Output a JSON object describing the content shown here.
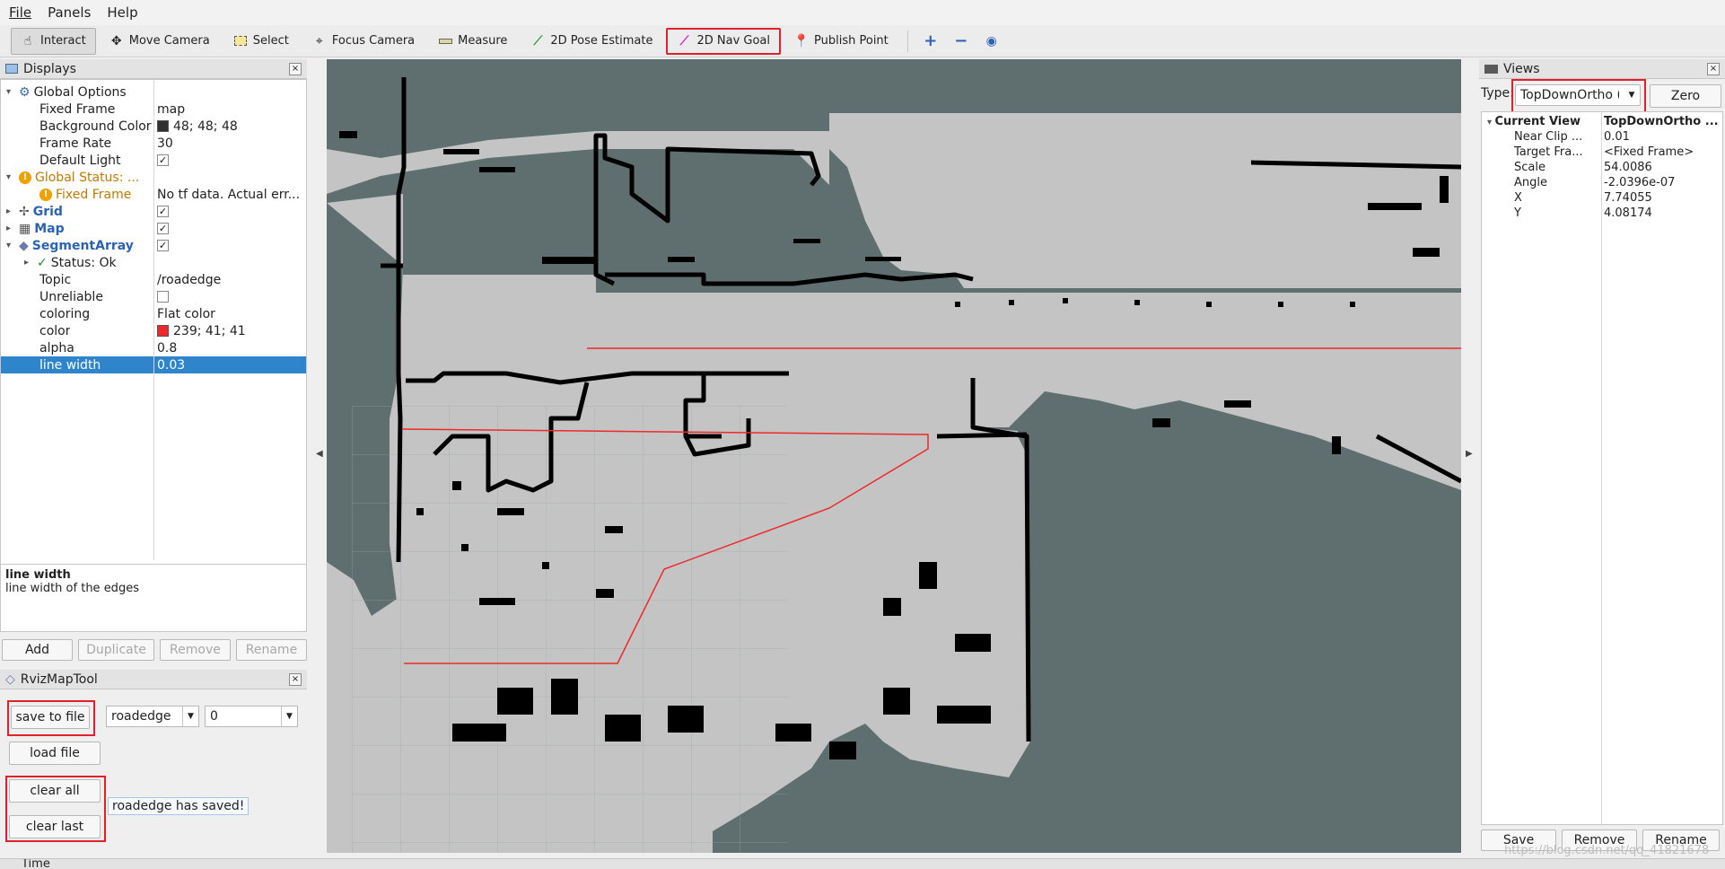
{
  "menu": {
    "file": "File",
    "panels": "Panels",
    "help": "Help"
  },
  "toolbar": {
    "interact": "Interact",
    "move_camera": "Move Camera",
    "select": "Select",
    "focus_camera": "Focus Camera",
    "measure": "Measure",
    "pose_estimate": "2D Pose Estimate",
    "nav_goal": "2D Nav Goal",
    "publish_point": "Publish Point"
  },
  "displays": {
    "title": "Displays",
    "rows": {
      "global_options": "Global Options",
      "fixed_frame_k": "Fixed Frame",
      "fixed_frame_v": "map",
      "bg_color_k": "Background Color",
      "bg_color_v": "48; 48; 48",
      "frame_rate_k": "Frame Rate",
      "frame_rate_v": "30",
      "default_light_k": "Default Light",
      "global_status_k": "Global Status: ...",
      "status_fixed_frame_k": "Fixed Frame",
      "status_fixed_frame_v": "No tf data.  Actual err...",
      "grid": "Grid",
      "map": "Map",
      "segment_array": "SegmentArray",
      "status_ok": "Status: Ok",
      "topic_k": "Topic",
      "topic_v": "/roadedge",
      "unreliable_k": "Unreliable",
      "coloring_k": "coloring",
      "coloring_v": "Flat color",
      "color_k": "color",
      "color_v": "239; 41; 41",
      "alpha_k": "alpha",
      "alpha_v": "0.8",
      "line_width_k": "line width",
      "line_width_v": "0.03"
    },
    "bg_swatch": "#303030",
    "color_swatch": "#ef2929",
    "description_title": "line width",
    "description_text": "line width of the edges",
    "buttons": {
      "add": "Add",
      "duplicate": "Duplicate",
      "remove": "Remove",
      "rename": "Rename"
    }
  },
  "rviz_map_tool": {
    "title": "RvizMapTool",
    "save_to_file": "save to file",
    "name_select": "roadedge",
    "index_select": "0",
    "load_file": "load file",
    "clear_all": "clear all",
    "clear_last": "clear last",
    "status_message": "roadedge has saved!"
  },
  "views": {
    "title": "Views",
    "type_label": "Type:",
    "type_value": "TopDownOrtho (",
    "zero_button": "Zero",
    "current_view_k": "Current View",
    "current_view_v": "TopDownOrtho ...",
    "near_clip_k": "Near Clip ...",
    "near_clip_v": "0.01",
    "target_frame_k": "Target Fra...",
    "target_frame_v": "<Fixed Frame>",
    "scale_k": "Scale",
    "scale_v": "54.0086",
    "angle_k": "Angle",
    "angle_v": "-2.0396e-07",
    "x_k": "X",
    "x_v": "7.74055",
    "y_k": "Y",
    "y_v": "4.08174",
    "buttons": {
      "save": "Save",
      "remove": "Remove",
      "rename": "Rename"
    }
  },
  "time_panel": {
    "title": "Time"
  },
  "watermark": "https://blog.csdn.net/qq_41821678",
  "colors": {
    "map_free": "#c4c4c4",
    "map_unknown": "#5f6e6e",
    "map_occupied": "#000000",
    "edge": "#ef2929",
    "selection": "#2f85cc",
    "highlight": "#e0202a"
  }
}
